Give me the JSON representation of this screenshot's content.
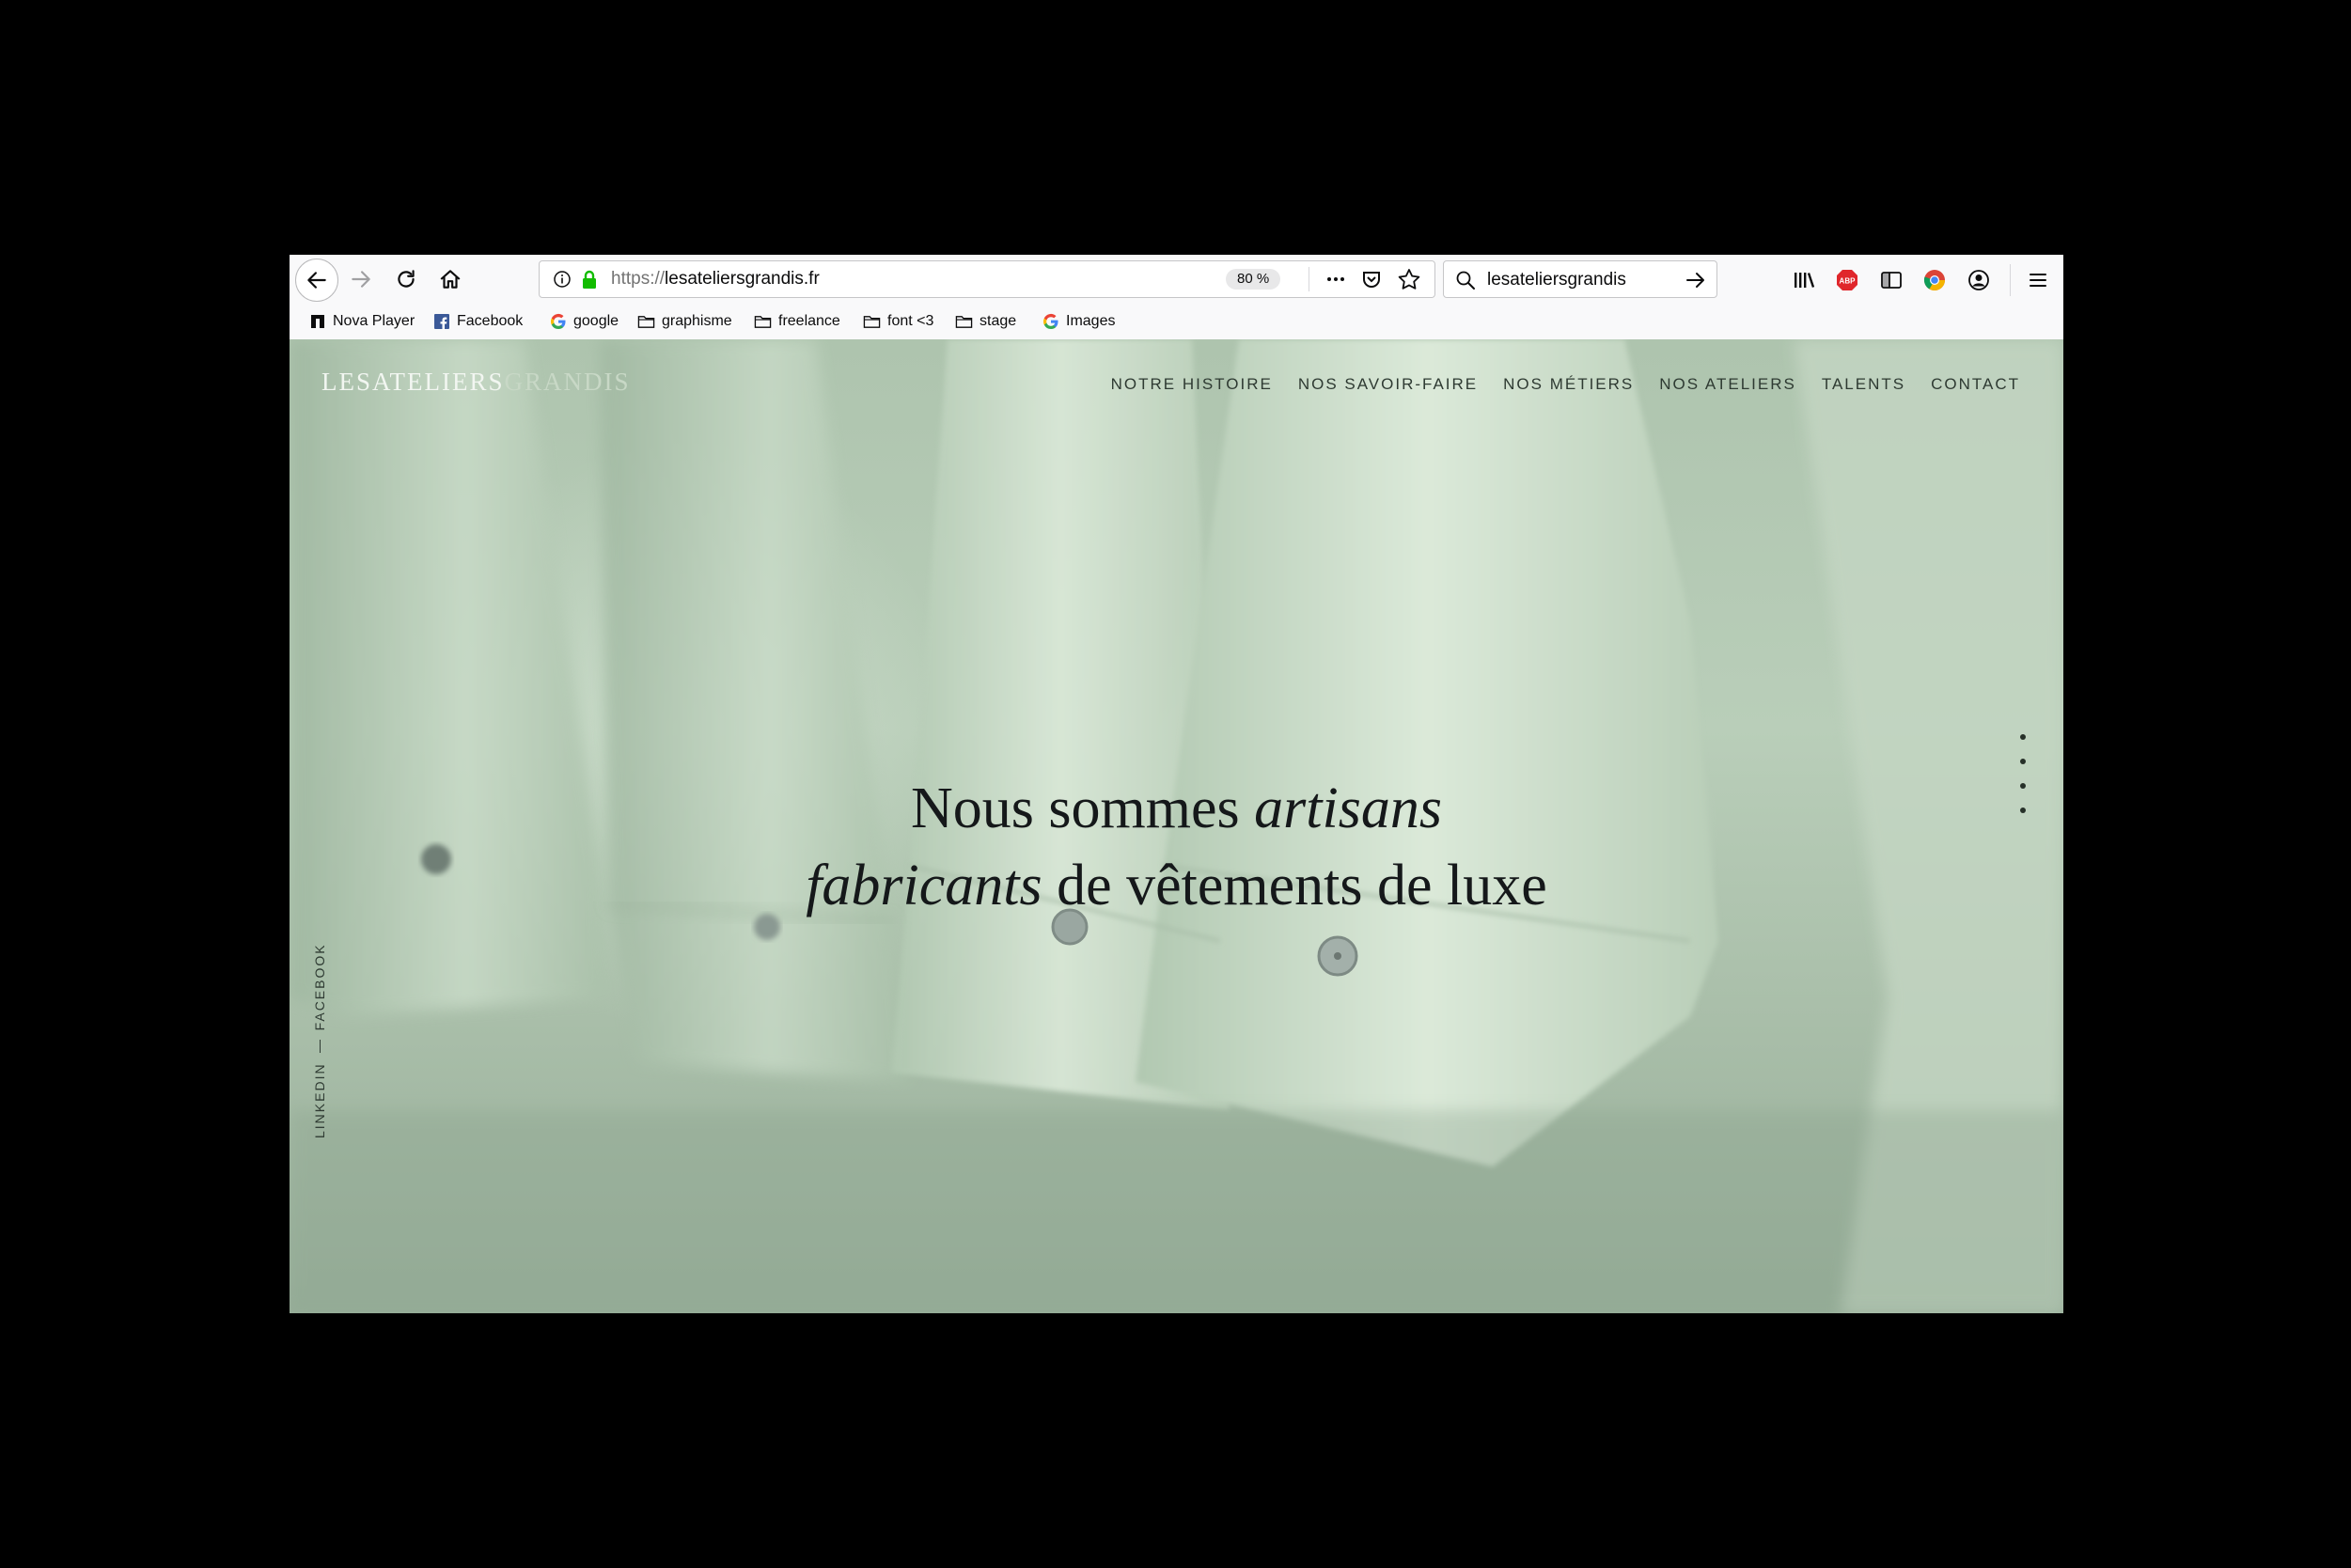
{
  "browser": {
    "url_protocol": "https://",
    "url_host": "lesateliersgrandis.fr",
    "zoom": "80 %",
    "search_value": "lesateliersgrandis",
    "icons": [
      "back-arrow-icon",
      "forward-arrow-icon",
      "reload-icon",
      "home-icon",
      "info-icon",
      "lock-icon",
      "more-icon",
      "pocket-icon",
      "star-icon",
      "search-icon",
      "arrow-right-icon",
      "library-icon",
      "adblock-plus-icon",
      "sidebar-icon",
      "chrome-icon",
      "account-icon",
      "hamburger-menu-icon"
    ]
  },
  "bookmarks": [
    {
      "label": "Nova Player",
      "icon": "nova-icon"
    },
    {
      "label": "Facebook",
      "icon": "facebook-icon"
    },
    {
      "label": "google",
      "icon": "google-icon"
    },
    {
      "label": "graphisme",
      "icon": "folder-icon"
    },
    {
      "label": "freelance",
      "icon": "folder-icon"
    },
    {
      "label": "font <3",
      "icon": "folder-icon"
    },
    {
      "label": "stage",
      "icon": "folder-icon"
    },
    {
      "label": "Images",
      "icon": "google-icon"
    }
  ],
  "site": {
    "logo_part1": "LES",
    "logo_part2": "ATELIERS",
    "logo_part3": "GRANDIS",
    "nav": [
      "NOTRE HISTOIRE",
      "NOS SAVOIR-FAIRE",
      "NOS MÉTIERS",
      "NOS ATELIERS",
      "TALENTS",
      "CONTACT"
    ],
    "social_linkedin": "LINKEDIN",
    "social_facebook": "FACEBOOK",
    "hero_line1_a": "Nous sommes ",
    "hero_line1_em": "artisans",
    "hero_line2_em": "fabricants",
    "hero_line2_b": " de vêtements de luxe"
  },
  "colors": {
    "accent_green_bg": "#b4cab4",
    "nav_text": "#2e3a32",
    "hero_text": "#15181a"
  }
}
